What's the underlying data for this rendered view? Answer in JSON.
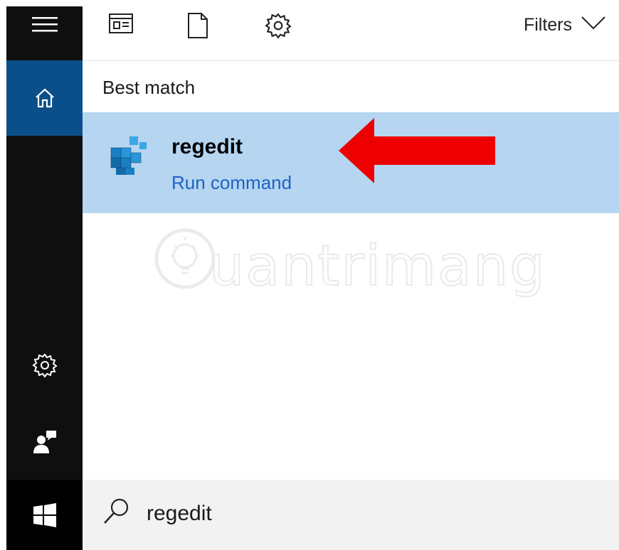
{
  "topbar": {
    "filters_label": "Filters"
  },
  "content": {
    "section_title": "Best match",
    "result": {
      "title": "regedit",
      "subtitle": "Run command"
    }
  },
  "watermark": {
    "text": "uantrimang"
  },
  "search": {
    "value": "regedit"
  },
  "icons": {
    "hamburger": "hamburger-menu-icon",
    "home": "home-icon",
    "settings": "gear-icon",
    "feedback": "feedback-icon",
    "start": "windows-logo-icon",
    "apps": "apps-filter-icon",
    "documents": "document-filter-icon",
    "settings_filter": "settings-filter-icon",
    "chevron": "chevron-down-icon",
    "search": "search-icon",
    "regedit": "registry-editor-icon"
  },
  "colors": {
    "sidebar": "#0f0f0f",
    "home_active": "#0b4f8a",
    "result_highlight": "#b5d5f0",
    "run_command": "#1e62c4",
    "arrow": "#ee0000",
    "searchbar": "#f2f2f2"
  }
}
